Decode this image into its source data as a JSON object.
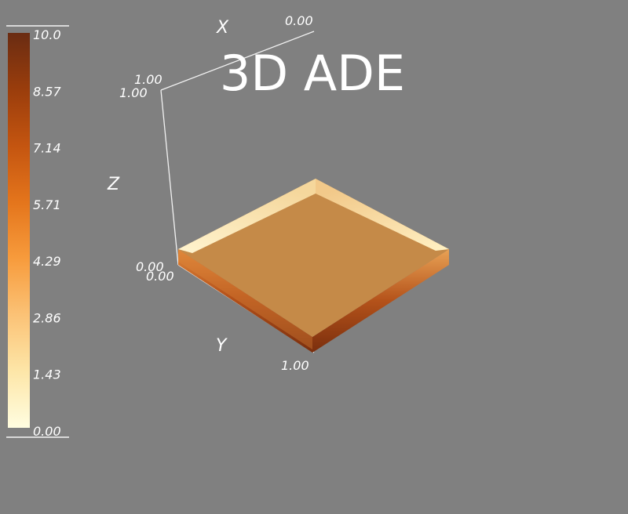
{
  "title": "3D ADE",
  "axes": {
    "x": {
      "name": "X",
      "min_label": "0.00",
      "max_label": "1.00"
    },
    "y": {
      "name": "Y",
      "min_label": "0.00",
      "max_label": "1.00"
    },
    "z": {
      "name": "Z",
      "min_label": "0.00",
      "max_label": "1.00"
    }
  },
  "colorbar": {
    "labels": [
      "10.0",
      "8.57",
      "7.14",
      "5.71",
      "4.29",
      "2.86",
      "1.43",
      "0.00"
    ],
    "range": [
      0,
      10
    ],
    "colormap": [
      "#fffde0",
      "#fde6a8",
      "#fbc276",
      "#f79b3c",
      "#e4751c",
      "#c45510",
      "#9a3d0c",
      "#6a2c12"
    ]
  },
  "slab": {
    "top_color": "#c58a48",
    "side_dark": "#8e3b0c",
    "edge_light": "#fcf0c4"
  }
}
